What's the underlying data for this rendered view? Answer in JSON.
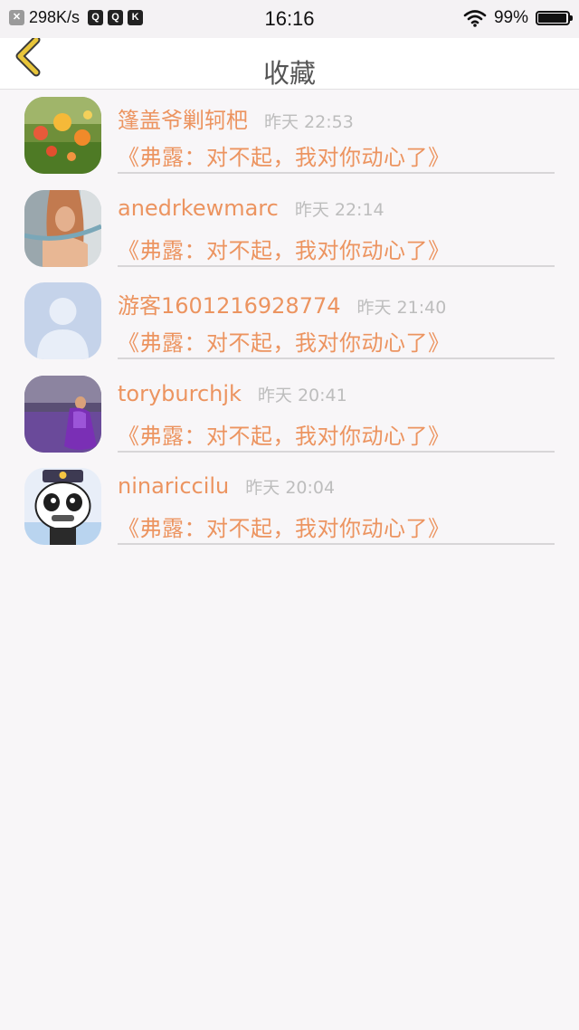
{
  "status_bar": {
    "net_speed": "298K/s",
    "time": "16:16",
    "battery": "99%",
    "app_icons": [
      "close-notification-icon",
      "qq-icon",
      "qq-icon",
      "k-app-icon"
    ]
  },
  "header": {
    "title": "收藏",
    "back_icon": "chevron-left-icon",
    "back_color": "#e8c53a"
  },
  "accent_color": "#ec9460",
  "favorites": [
    {
      "name": "篷盖爷剿轲杷",
      "time": "昨天 22:53",
      "topic": "《弗露：对不起，我对你动心了》",
      "avatar": "flowers-photo"
    },
    {
      "name": "anedrkewmarc",
      "time": "昨天 22:14",
      "topic": "《弗露：对不起，我对你动心了》",
      "avatar": "woman-photo"
    },
    {
      "name": "游客1601216928774",
      "time": "昨天 21:40",
      "topic": "《弗露：对不起，我对你动心了》",
      "avatar": "default-avatar"
    },
    {
      "name": "toryburchjk",
      "time": "昨天 20:41",
      "topic": "《弗露：对不起，我对你动心了》",
      "avatar": "lavender-field-photo"
    },
    {
      "name": "ninariccilu",
      "time": "昨天 20:04",
      "topic": "《弗露：对不起，我对你动心了》",
      "avatar": "panda-cartoon"
    }
  ]
}
